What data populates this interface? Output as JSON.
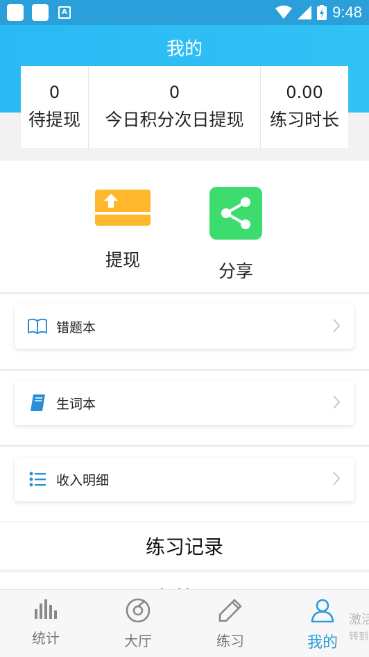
{
  "status_bar": {
    "time": "9:48"
  },
  "header": {
    "title": "我的"
  },
  "stats": [
    {
      "value": "0",
      "label": "待提现"
    },
    {
      "value": "0",
      "label": "今日积分次日提现"
    },
    {
      "value": "0.00",
      "label": "练习时长"
    }
  ],
  "actions": {
    "withdraw_label": "提现",
    "share_label": "分享"
  },
  "list": {
    "wrong_book": "错题本",
    "vocab_book": "生词本",
    "income_detail": "收入明细"
  },
  "practice_record": {
    "title": "练习记录"
  },
  "peek_next": {
    "text": "已归档词汇"
  },
  "tabs": [
    {
      "label": "统计"
    },
    {
      "label": "大厅"
    },
    {
      "label": "练习"
    },
    {
      "label": "我的"
    }
  ],
  "peek_right": {
    "line1": "激活",
    "line2": "转到"
  },
  "colors": {
    "header_blue": "#2ab9f4",
    "active_tab": "#2a9de0",
    "withdraw_orange": "#ffb82e",
    "share_green": "#3ddc6f"
  }
}
